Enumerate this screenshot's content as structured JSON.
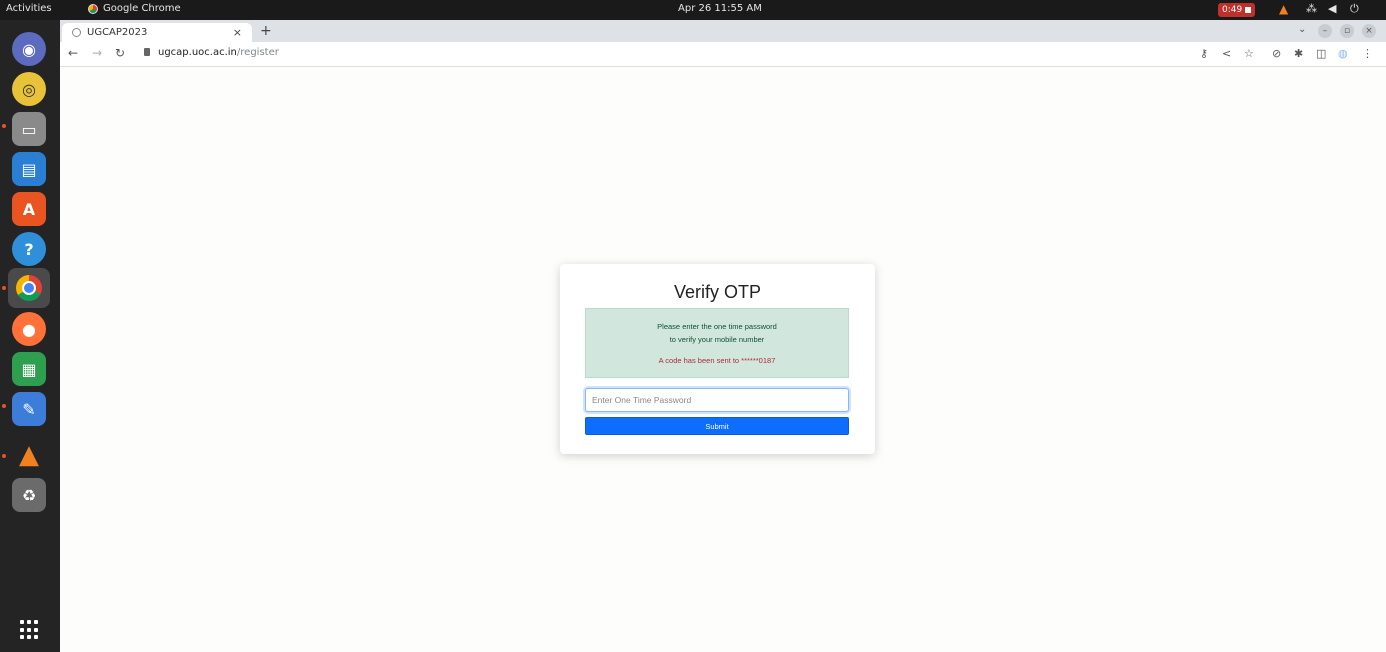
{
  "topbar": {
    "activities": "Activities",
    "app_name": "Google Chrome",
    "clock": "Apr 26  11:55 AM",
    "recording": "0:49"
  },
  "dock": {
    "items": [
      "Chromium",
      "Rhythmbox",
      "Files",
      "LibreOffice Writer",
      "Ubuntu Software",
      "Help",
      "Google Chrome",
      "Firefox",
      "LibreOffice Calc",
      "Text Editor",
      "VLC",
      "Trash"
    ]
  },
  "browser": {
    "tab_title": "UGCAP2023",
    "tab_close": "×",
    "new_tab": "+",
    "url_host": "ugcap.uoc.ac.in",
    "url_path": "/register"
  },
  "card": {
    "title": "Verify OTP",
    "message_line1": "Please enter the one time password",
    "message_line2": "to verify your mobile number",
    "code_sent": "A code has been sent to ******0187",
    "otp_placeholder": "Enter One Time Password",
    "submit_label": "Submit"
  },
  "colors": {
    "primary": "#0d6efd",
    "alert_bg": "#d1e7dd",
    "alert_text": "#0f5132",
    "danger_text": "#b02a37"
  }
}
